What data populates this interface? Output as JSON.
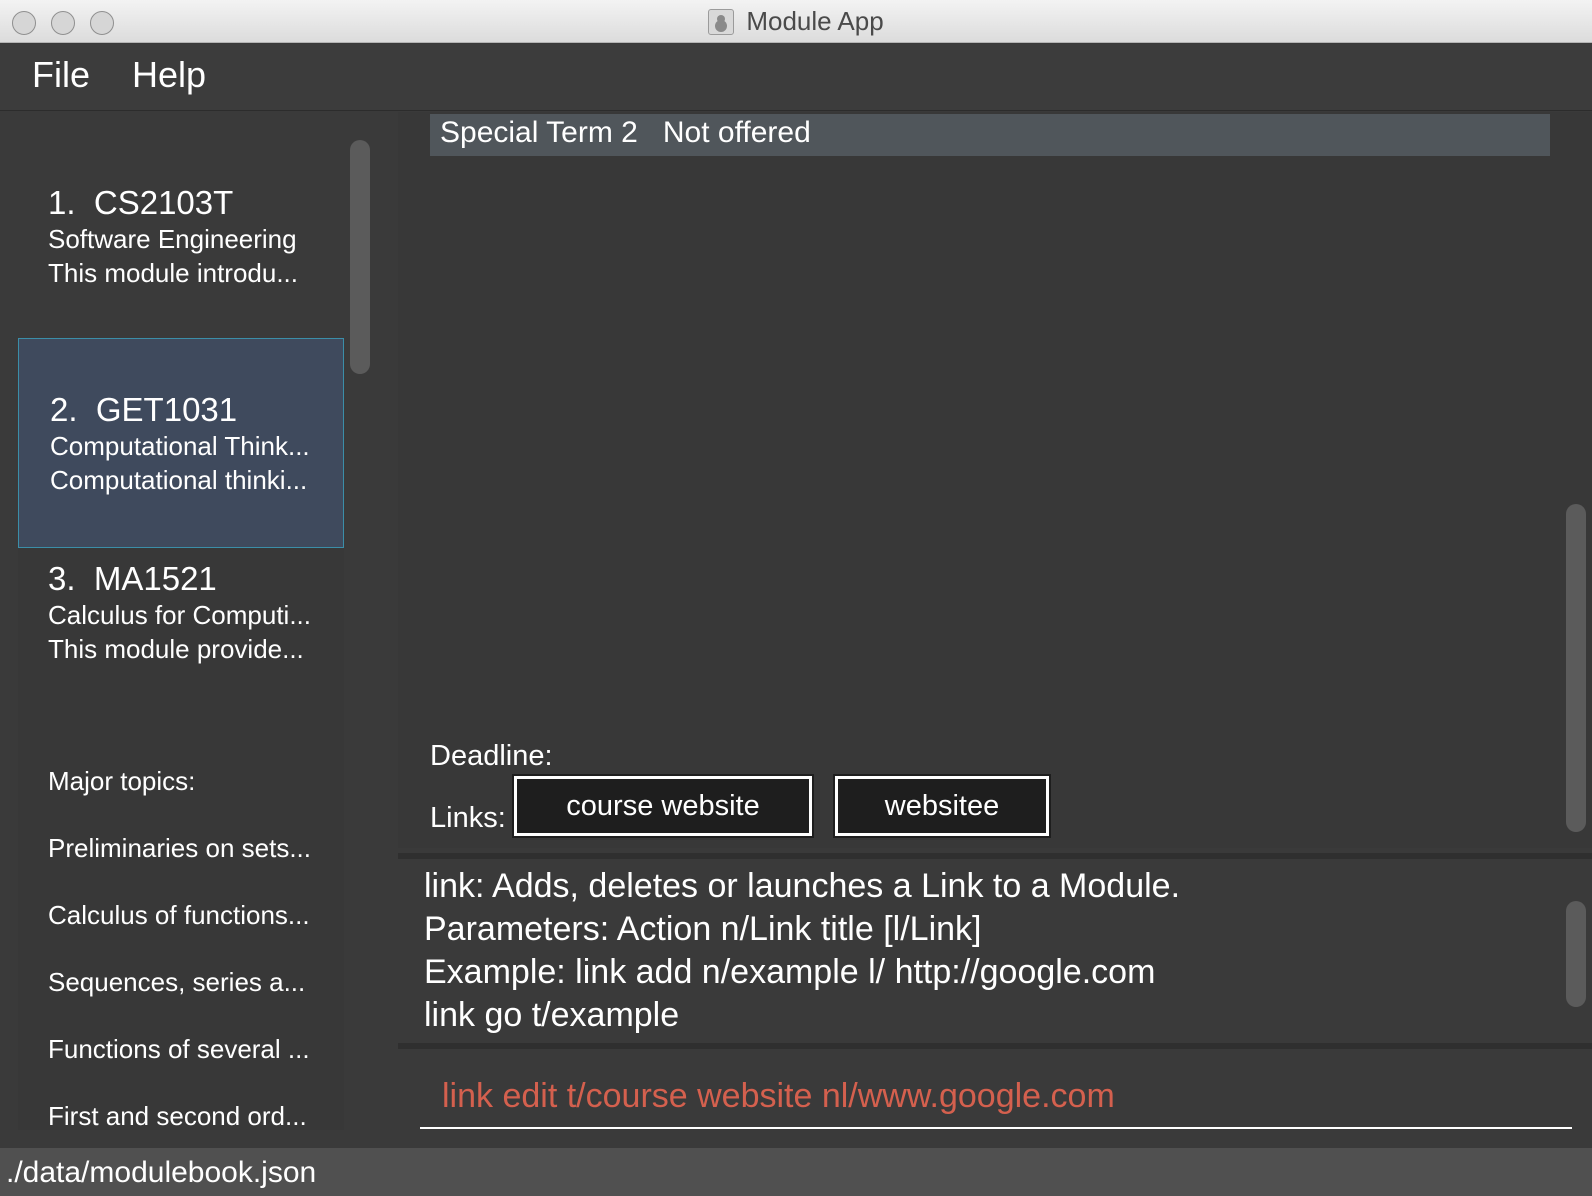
{
  "window": {
    "title": "Module App"
  },
  "menu": {
    "file": "File",
    "help": "Help"
  },
  "modules": [
    {
      "index": "1.",
      "code": "CS2103T",
      "name": "Software Engineering",
      "desc": "This module introdu..."
    },
    {
      "index": "2.",
      "code": "GET1031",
      "name": "Computational Think...",
      "desc": "Computational thinki..."
    },
    {
      "index": "3.",
      "code": "MA1521",
      "name": "Calculus for Computi...",
      "desc": "This module provide..."
    }
  ],
  "topics": {
    "heading": "Major topics:",
    "items": [
      "Preliminaries on sets...",
      "Calculus of functions...",
      "Sequences, series a...",
      "Functions of several ...",
      "First and second ord..."
    ]
  },
  "detail": {
    "term": "Special Term 2",
    "status": "Not offered",
    "deadline_label": "Deadline:",
    "links_label": "Links:",
    "links": [
      "course website",
      "websitee"
    ]
  },
  "result": {
    "lines": [
      "link: Adds, deletes or launches a Link to a Module.",
      "Parameters: Action n/Link title [l/Link]",
      "Example: link add n/example l/ http://google.com",
      "link go t/example"
    ]
  },
  "command": {
    "value": "link edit t/course website nl/www.google.com"
  },
  "status": {
    "path": "./data/modulebook.json"
  },
  "colors": {
    "selected_bg": "#3f4a5d",
    "selected_border": "#3b8ea8",
    "command_text": "#d4604e",
    "panel_bg": "#383838"
  }
}
